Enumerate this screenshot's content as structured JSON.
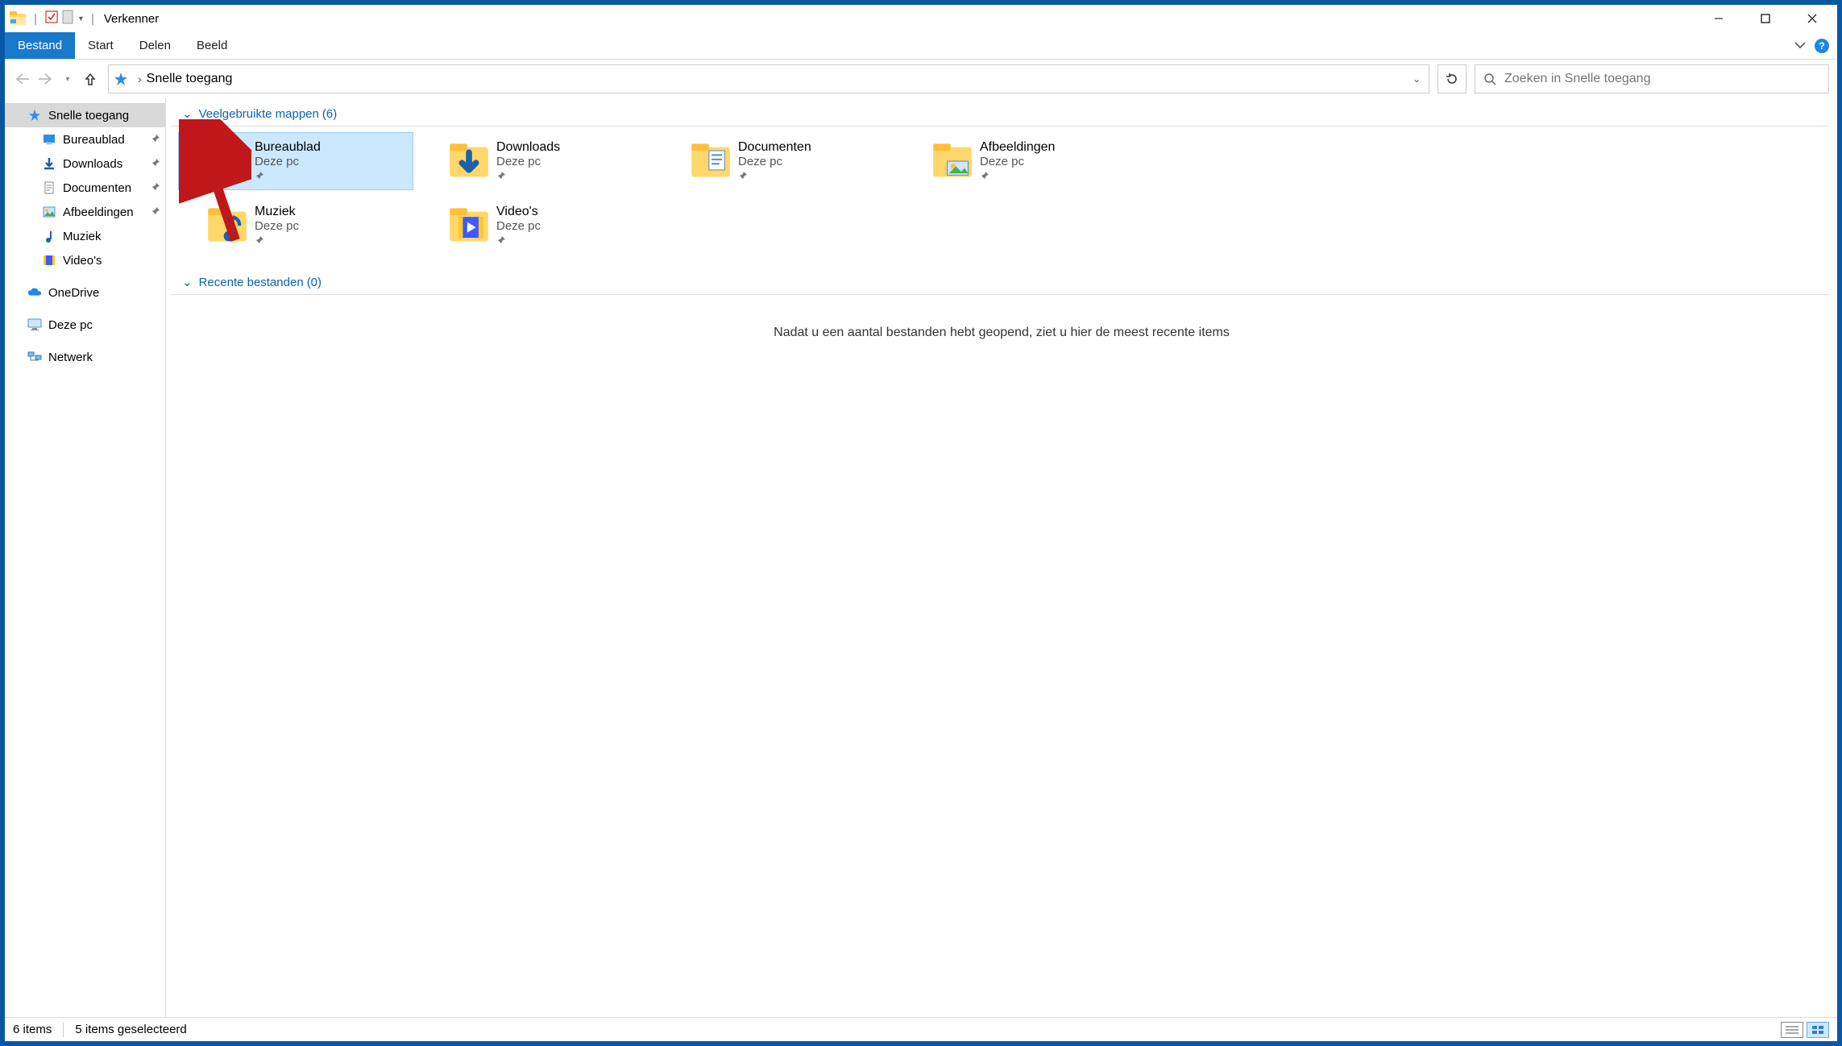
{
  "titlebar": {
    "title": "Verkenner"
  },
  "ribbon": {
    "file_tab": "Bestand",
    "tabs": [
      "Start",
      "Delen",
      "Beeld"
    ]
  },
  "addressbar": {
    "location": "Snelle toegang"
  },
  "search": {
    "placeholder": "Zoeken in Snelle toegang"
  },
  "sidebar": {
    "quick_access": {
      "label": "Snelle toegang"
    },
    "quick_items": [
      {
        "label": "Bureaublad",
        "icon": "desktop",
        "pinned": true
      },
      {
        "label": "Downloads",
        "icon": "downloads",
        "pinned": true
      },
      {
        "label": "Documenten",
        "icon": "documents",
        "pinned": true
      },
      {
        "label": "Afbeeldingen",
        "icon": "pictures",
        "pinned": true
      },
      {
        "label": "Muziek",
        "icon": "music",
        "pinned": false
      },
      {
        "label": "Video's",
        "icon": "videos",
        "pinned": false
      }
    ],
    "onedrive": {
      "label": "OneDrive"
    },
    "this_pc": {
      "label": "Deze pc"
    },
    "network": {
      "label": "Netwerk"
    }
  },
  "content": {
    "group_frequent": {
      "label": "Veelgebruikte mappen",
      "count": "(6)"
    },
    "group_recent": {
      "label": "Recente bestanden",
      "count": "(0)"
    },
    "location_label": "Deze pc",
    "empty_recent": "Nadat u een aantal bestanden hebt geopend, ziet u hier de meest recente items",
    "folders": [
      {
        "name": "Bureaublad",
        "icon": "desktop",
        "selected": true,
        "checked": true
      },
      {
        "name": "Downloads",
        "icon": "downloads",
        "selected": false,
        "checked": false
      },
      {
        "name": "Documenten",
        "icon": "documents",
        "selected": false,
        "checked": false
      },
      {
        "name": "Afbeeldingen",
        "icon": "pictures",
        "selected": false,
        "checked": false
      },
      {
        "name": "Muziek",
        "icon": "music",
        "selected": false,
        "checked": false
      },
      {
        "name": "Video's",
        "icon": "videos",
        "selected": false,
        "checked": false
      }
    ]
  },
  "statusbar": {
    "items": "6 items",
    "selected": "5 items geselecteerd"
  }
}
